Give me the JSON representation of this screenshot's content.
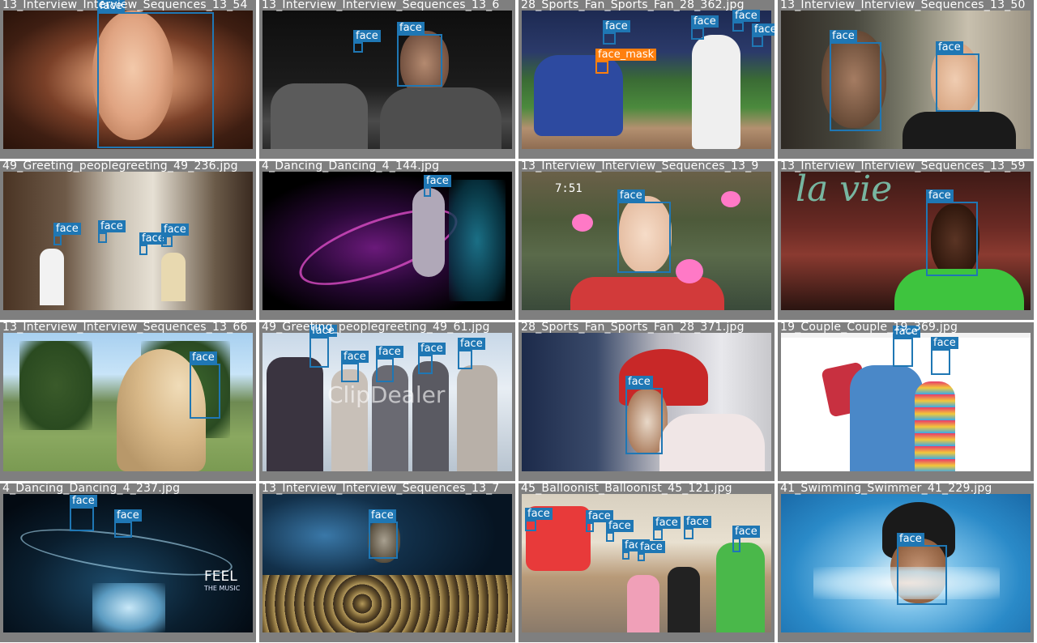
{
  "grid": {
    "tiles": [
      {
        "filename": "13_Interview_Interview_Sequences_13_54",
        "labels": [
          "face"
        ]
      },
      {
        "filename": "13_Interview_Interview_Sequences_13_6",
        "labels": [
          "face",
          "face"
        ]
      },
      {
        "filename": "28_Sports_Fan_Sports_Fan_28_362.jpg",
        "labels": [
          "face",
          "face",
          "face",
          "face",
          "face_mask"
        ]
      },
      {
        "filename": "13_Interview_Interview_Sequences_13_50",
        "labels": [
          "face",
          "face"
        ]
      },
      {
        "filename": "49_Greeting_peoplegreeting_49_236.jpg",
        "labels": [
          "face",
          "face",
          "face",
          "face"
        ]
      },
      {
        "filename": "4_Dancing_Dancing_4_144.jpg",
        "labels": [
          "face"
        ]
      },
      {
        "filename": "13_Interview_Interview_Sequences_13_9",
        "labels": [
          "face"
        ],
        "overlay_text": "7:51"
      },
      {
        "filename": "13_Interview_Interview_Sequences_13_59",
        "labels": [
          "face"
        ],
        "overlay_text": "la vie"
      },
      {
        "filename": "13_Interview_Interview_Sequences_13_66",
        "labels": [
          "face"
        ]
      },
      {
        "filename": "49_Greeting_peoplegreeting_49_61.jpg",
        "labels": [
          "face",
          "face",
          "face",
          "face",
          "face"
        ],
        "overlay_text": "ClipDealer"
      },
      {
        "filename": "28_Sports_Fan_Sports_Fan_28_371.jpg",
        "labels": [
          "face"
        ]
      },
      {
        "filename": "19_Couple_Couple_19_369.jpg",
        "labels": [
          "face",
          "face"
        ]
      },
      {
        "filename": "4_Dancing_Dancing_4_237.jpg",
        "labels": [
          "face",
          "face"
        ],
        "overlay_text": "FEEL",
        "overlay_sub": "THE MUSIC"
      },
      {
        "filename": "13_Interview_Interview_Sequences_13_7",
        "labels": [
          "face"
        ]
      },
      {
        "filename": "45_Balloonist_Balloonist_45_121.jpg",
        "labels": [
          "face",
          "face",
          "face",
          "face",
          "face",
          "face",
          "face",
          "face"
        ]
      },
      {
        "filename": "41_Swimming_Swimmer_41_229.jpg",
        "labels": [
          "face"
        ]
      }
    ]
  },
  "colors": {
    "face": "#1f77b4",
    "face_mask": "#ff7f0e",
    "tile_border": "#7f7f7f",
    "label_text": "#ffffff"
  }
}
